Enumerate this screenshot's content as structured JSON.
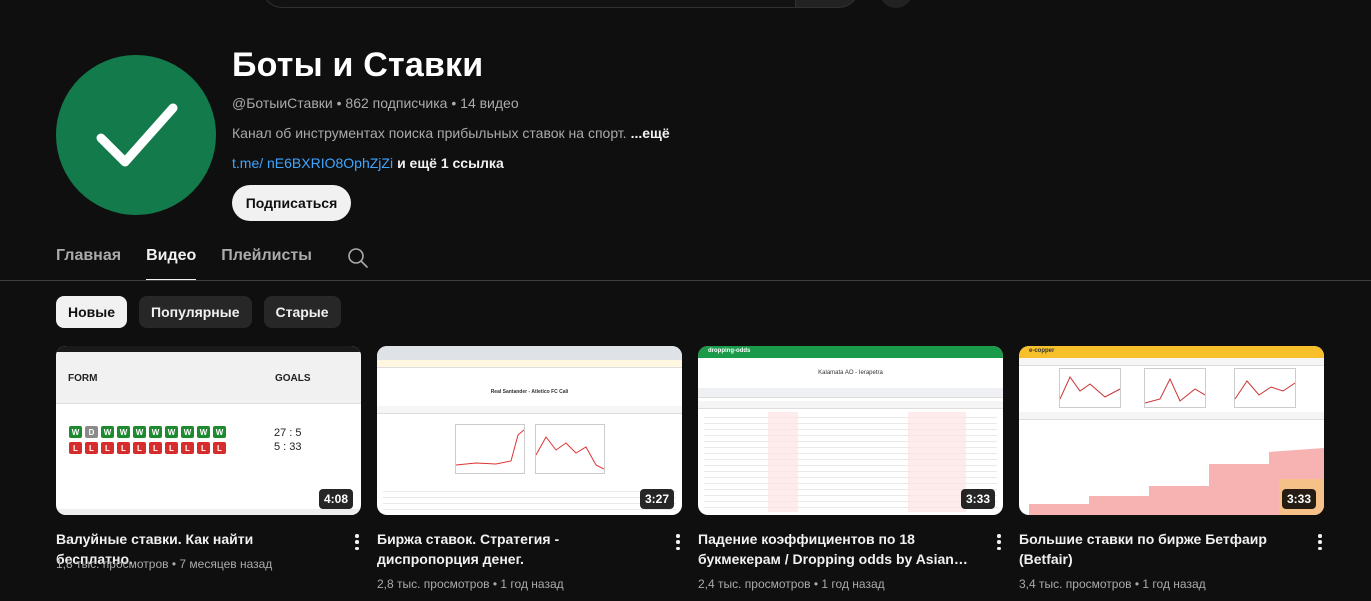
{
  "channel": {
    "name": "Боты и Ставки",
    "handle": "@БотыиСтавки",
    "subscribers": "862 подписчика",
    "video_count": "14 видео",
    "meta_separator": " • ",
    "description": "Канал об инструментах поиска прибыльных ставок на спорт.",
    "description_more": "...ещё",
    "link": "t.me/ nE6BXRIO8OphZjZi",
    "more_links": "и ещё 1 ссылка",
    "subscribe_label": "Подписаться",
    "avatar_icon": "checkmark-icon",
    "avatar_color": "#137a4b"
  },
  "tabs": [
    {
      "label": "Главная",
      "active": false
    },
    {
      "label": "Видео",
      "active": true
    },
    {
      "label": "Плейлисты",
      "active": false
    }
  ],
  "tab_search_icon": "search-icon",
  "chips": [
    {
      "label": "Новые",
      "active": true
    },
    {
      "label": "Популярные",
      "active": false
    },
    {
      "label": "Старые",
      "active": false
    }
  ],
  "videos": [
    {
      "title": "Валуйные ставки. Как найти бесплатно.",
      "views": "1,8 тыс. просмотров",
      "age": "7 месяцев назад",
      "duration": "4:08",
      "thumb": {
        "form_label": "FORM",
        "goals_label": "GOALS",
        "row1": [
          "W",
          "D",
          "W",
          "W",
          "W",
          "W",
          "W",
          "W",
          "W",
          "W"
        ],
        "row2": [
          "L",
          "L",
          "L",
          "L",
          "L",
          "L",
          "L",
          "L",
          "L",
          "L"
        ],
        "score1": "27 : 5",
        "score2": "5 : 33"
      }
    },
    {
      "title": "Биржа ставок. Стратегия - диспропорция денег.",
      "views": "2,8 тыс. просмотров",
      "age": "1 год назад",
      "duration": "3:27",
      "thumb": {
        "match": "Real Santander - Atletico FC Cali"
      }
    },
    {
      "title": "Падение коэффициентов по 18 букмекерам / Dropping odds by Asian…",
      "views": "2,4 тыс. просмотров",
      "age": "1 год назад",
      "duration": "3:33",
      "thumb": {
        "brand": "dropping-odds",
        "match": "Kalamata AO - Ierapetra"
      }
    },
    {
      "title": "Большие ставки по бирже Бетфаир (Betfair)",
      "views": "3,4 тыс. просмотров",
      "age": "1 год назад",
      "duration": "3:33",
      "thumb": {
        "brand": "e-copper"
      }
    }
  ],
  "more_actions_icon": "more-vert-icon"
}
